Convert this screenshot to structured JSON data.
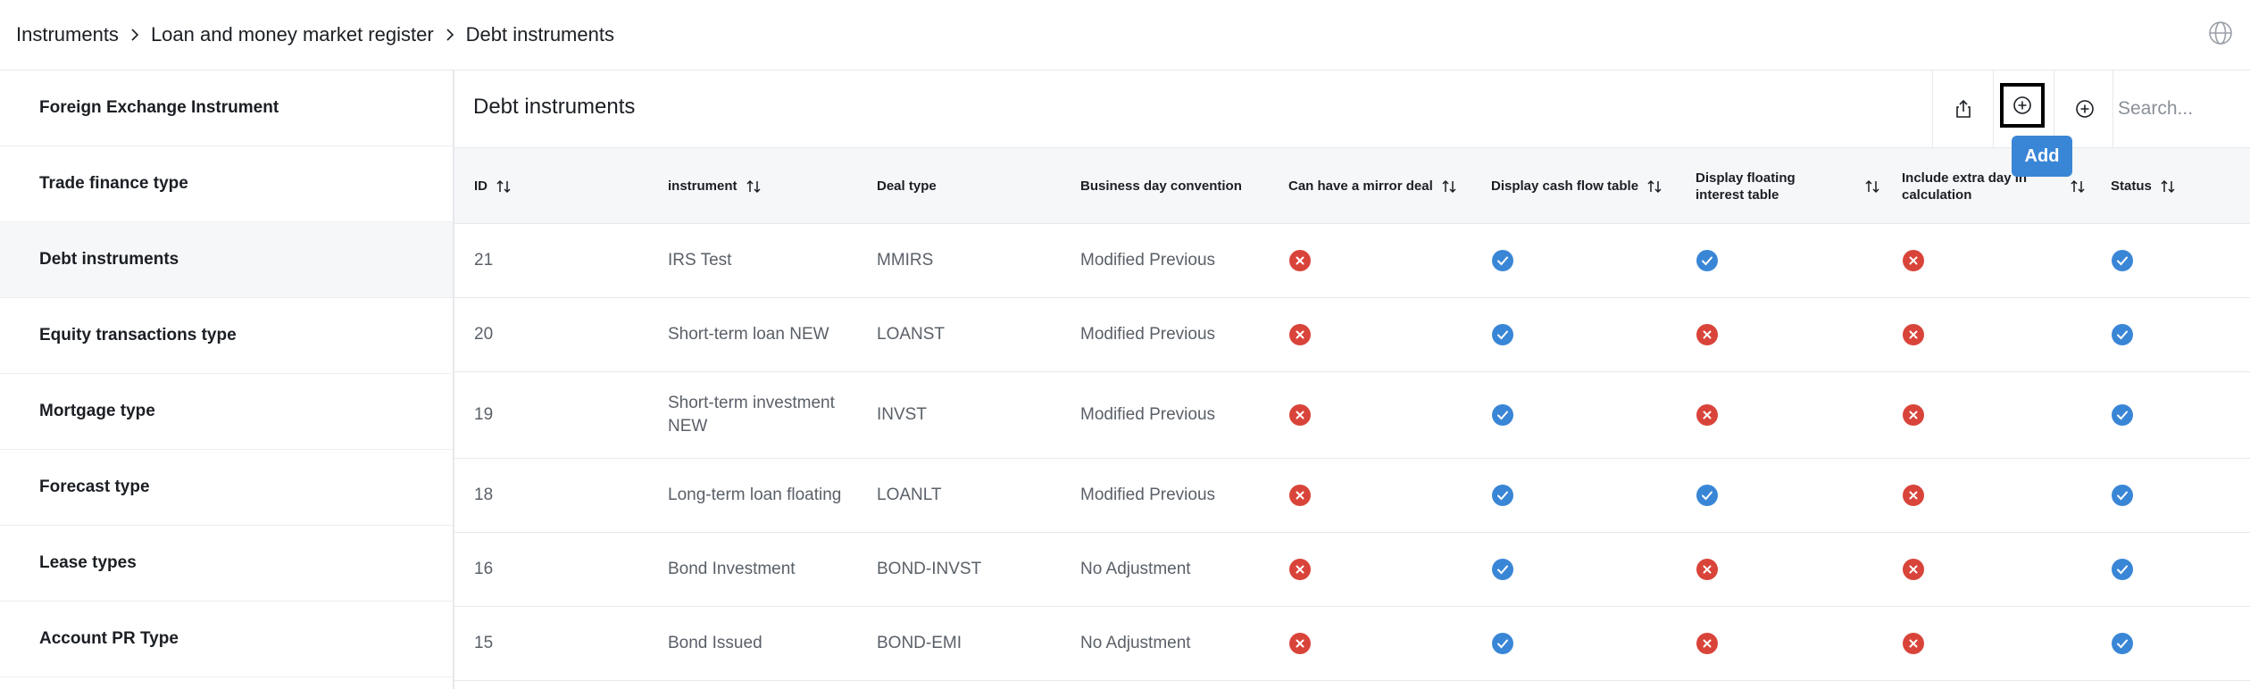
{
  "breadcrumb": [
    {
      "label": "Instruments"
    },
    {
      "label": "Loan and money market register"
    },
    {
      "label": "Debt instruments"
    }
  ],
  "sidebar": {
    "items": [
      {
        "label": "Foreign Exchange Instrument",
        "active": false
      },
      {
        "label": "Trade finance type",
        "active": false
      },
      {
        "label": "Debt instruments",
        "active": true
      },
      {
        "label": "Equity transactions type",
        "active": false
      },
      {
        "label": "Mortgage type",
        "active": false
      },
      {
        "label": "Forecast type",
        "active": false
      },
      {
        "label": "Lease types",
        "active": false
      },
      {
        "label": "Account PR Type",
        "active": false
      }
    ]
  },
  "main": {
    "title": "Debt instruments",
    "search_placeholder": "Search...",
    "add_tooltip": "Add"
  },
  "table": {
    "columns": [
      {
        "key": "id",
        "label": "ID",
        "sortable": true
      },
      {
        "key": "instrument",
        "label": "instrument",
        "sortable": true
      },
      {
        "key": "deal_type",
        "label": "Deal type",
        "sortable": false
      },
      {
        "key": "bdc",
        "label": "Business day convention",
        "sortable": false
      },
      {
        "key": "mirror",
        "label": "Can have a mirror deal",
        "sortable": true
      },
      {
        "key": "cashflow",
        "label": "Display cash flow table",
        "sortable": true
      },
      {
        "key": "floating",
        "label": "Display floating interest table",
        "sortable": true
      },
      {
        "key": "extraday",
        "label": "Include extra day in calculation",
        "sortable": true
      },
      {
        "key": "status",
        "label": "Status",
        "sortable": true
      }
    ],
    "rows": [
      {
        "id": "21",
        "instrument": "IRS Test",
        "deal_type": "MMIRS",
        "bdc": "Modified Previous",
        "mirror": false,
        "cashflow": true,
        "floating": true,
        "extraday": false,
        "status": true
      },
      {
        "id": "20",
        "instrument": "Short-term loan NEW",
        "deal_type": "LOANST",
        "bdc": "Modified Previous",
        "mirror": false,
        "cashflow": true,
        "floating": false,
        "extraday": false,
        "status": true
      },
      {
        "id": "19",
        "instrument": "Short-term investment NEW",
        "deal_type": "INVST",
        "bdc": "Modified Previous",
        "mirror": false,
        "cashflow": true,
        "floating": false,
        "extraday": false,
        "status": true
      },
      {
        "id": "18",
        "instrument": "Long-term loan floating",
        "deal_type": "LOANLT",
        "bdc": "Modified Previous",
        "mirror": false,
        "cashflow": true,
        "floating": true,
        "extraday": false,
        "status": true
      },
      {
        "id": "16",
        "instrument": "Bond Investment",
        "deal_type": "BOND-INVST",
        "bdc": "No Adjustment",
        "mirror": false,
        "cashflow": true,
        "floating": false,
        "extraday": false,
        "status": true
      },
      {
        "id": "15",
        "instrument": "Bond Issued",
        "deal_type": "BOND-EMI",
        "bdc": "No Adjustment",
        "mirror": false,
        "cashflow": true,
        "floating": false,
        "extraday": false,
        "status": true
      }
    ]
  },
  "colors": {
    "check": "#3a86d6",
    "cross": "#d9443a"
  }
}
